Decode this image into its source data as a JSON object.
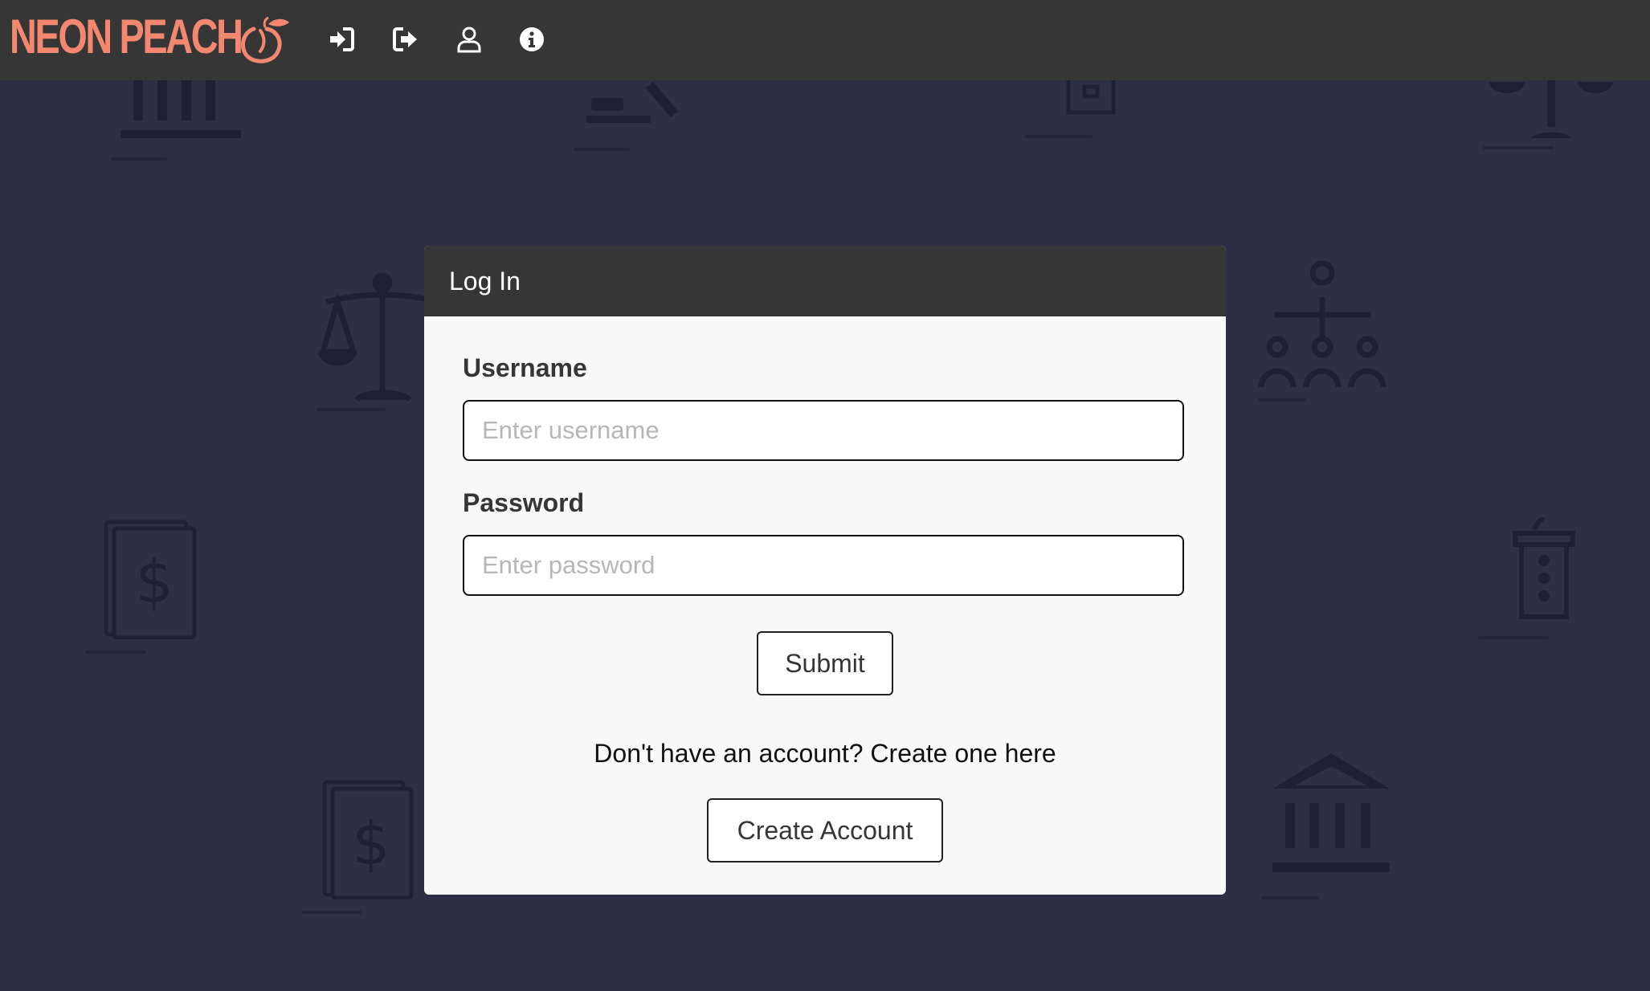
{
  "brand": {
    "name": "NEON PEACH",
    "color": "#f4876f"
  },
  "nav": {
    "icons": [
      {
        "name": "login-icon"
      },
      {
        "name": "logout-icon"
      },
      {
        "name": "user-icon"
      },
      {
        "name": "info-icon"
      }
    ]
  },
  "colors": {
    "navbar_bg": "#363636",
    "page_bg": "#2e2f45",
    "modal_bg": "#f9f9f9",
    "decoration": "#1f2033"
  },
  "modal": {
    "title": "Log In",
    "username_label": "Username",
    "username_placeholder": "Enter username",
    "username_value": "",
    "password_label": "Password",
    "password_placeholder": "Enter password",
    "password_value": "",
    "submit_label": "Submit",
    "signup_prompt": "Don't have an account? Create one here",
    "create_account_label": "Create Account"
  },
  "background_icons": [
    "courthouse-icon",
    "gavel-icon",
    "ballot-box-icon",
    "scales-icon",
    "scales-icon",
    "voters-icon",
    "money-document-icon",
    "podium-icon",
    "money-document-icon",
    "courthouse-icon"
  ]
}
